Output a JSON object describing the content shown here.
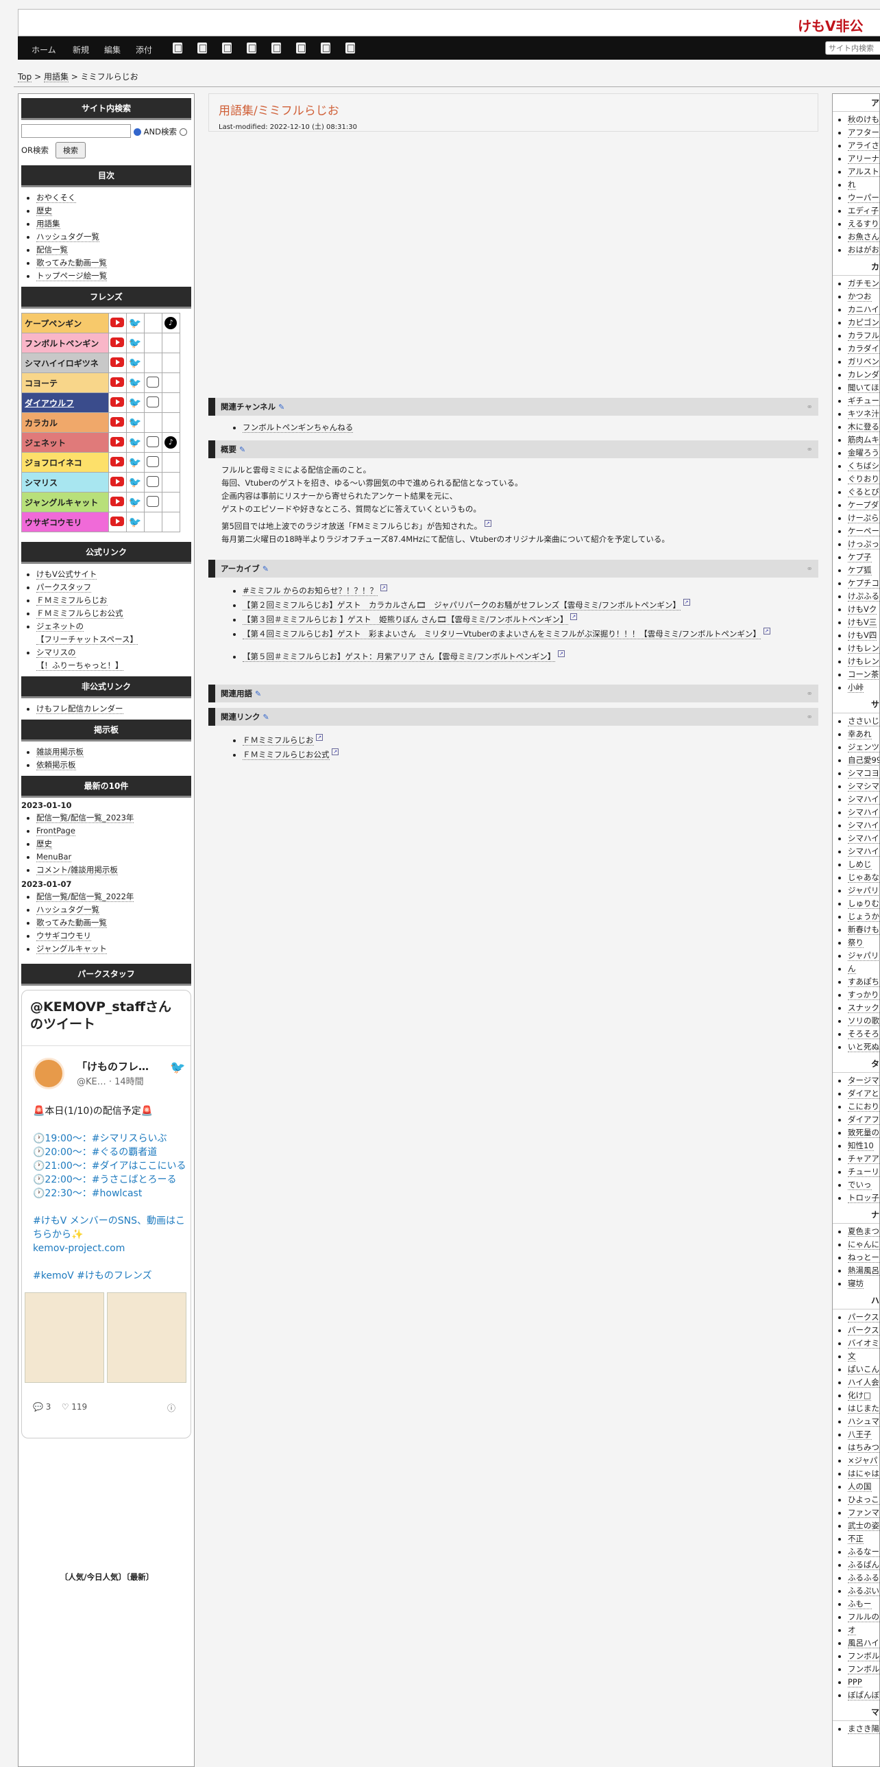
{
  "header": {
    "site_title": "けもV非公"
  },
  "nav": {
    "items": [
      "ホーム",
      "新規",
      "編集",
      "添付"
    ],
    "search_placeholder": "サイト内検索"
  },
  "breadcrumb": {
    "top": "Top",
    "sep": " > ",
    "glossary": "用語集",
    "current": "ミミフルらじお"
  },
  "left": {
    "search": {
      "heading": "サイト内検索",
      "and_label": "AND検索",
      "or_label": "OR検索",
      "button": "検索"
    },
    "toc": {
      "heading": "目次",
      "items": [
        "おやくそく",
        "歴史",
        "用語集",
        "ハッシュタグ一覧",
        "配信一覧",
        "歌ってみた動画一覧",
        "トップページ絵一覧"
      ]
    },
    "friends": {
      "heading": "フレンズ",
      "rows": [
        {
          "name": "ケープペンギン",
          "color": "#f7c96b",
          "icons": [
            "yt",
            "tw",
            "",
            "tk"
          ]
        },
        {
          "name": "フンボルトペンギン",
          "color": "#f9b6c8",
          "icons": [
            "yt",
            "tw",
            "",
            ""
          ]
        },
        {
          "name": "シマハイイロギツネ",
          "color": "#c8c8c8",
          "icons": [
            "yt",
            "tw",
            "",
            ""
          ]
        },
        {
          "name": "コヨーテ",
          "color": "#f8d68a",
          "icons": [
            "yt",
            "tw",
            "fc",
            ""
          ]
        },
        {
          "name": "ダイアウルフ",
          "color": "#3a4c8c",
          "icons": [
            "yt",
            "tw",
            "fc",
            ""
          ]
        },
        {
          "name": "カラカル",
          "color": "#f0a86a",
          "icons": [
            "yt",
            "tw",
            "",
            ""
          ]
        },
        {
          "name": "ジェネット",
          "color": "#e07a7a",
          "icons": [
            "yt",
            "tw",
            "fc",
            "tk"
          ]
        },
        {
          "name": "ジョフロイネコ",
          "color": "#fde06a",
          "icons": [
            "yt",
            "tw",
            "fc",
            ""
          ]
        },
        {
          "name": "シマリス",
          "color": "#a8e6f0",
          "icons": [
            "yt",
            "tw",
            "fc",
            ""
          ]
        },
        {
          "name": "ジャングルキャット",
          "color": "#b8e07a",
          "icons": [
            "yt",
            "tw",
            "fc",
            ""
          ]
        },
        {
          "name": "ウサギコウモリ",
          "color": "#f06ad8",
          "icons": [
            "yt",
            "tw",
            "",
            ""
          ]
        }
      ]
    },
    "official": {
      "heading": "公式リンク",
      "items": [
        "けもV公式サイト",
        "パークスタッフ",
        "ＦＭミミフルらじお",
        "ＦＭミミフルらじお公式",
        "ジェネットの\n【フリーチャットスペース】",
        "シマリスの\n【！ふりーちゃっと！】"
      ]
    },
    "unofficial": {
      "heading": "非公式リンク",
      "items": [
        "けもフレ配信カレンダー"
      ]
    },
    "bbs": {
      "heading": "掲示板",
      "items": [
        "雑談用掲示板",
        "依頼掲示板"
      ]
    },
    "recent": {
      "heading": "最新の10件",
      "groups": [
        {
          "date": "2023-01-10",
          "items": [
            "配信一覧/配信一覧_2023年",
            "FrontPage",
            "歴史",
            "MenuBar",
            "コメント/雑談用掲示板"
          ]
        },
        {
          "date": "2023-01-07",
          "items": [
            "配信一覧/配信一覧_2022年",
            "ハッシュタグ一覧",
            "歌ってみた動画一覧",
            "ウサギコウモリ",
            "ジャングルキャット"
          ]
        }
      ]
    },
    "staff": {
      "heading": "パークスタッフ"
    },
    "tweet": {
      "heading": "@KEMOVP_staffさんのツイート",
      "name": "「けものフレ…",
      "handle": "@KE… · 14時間",
      "lines": [
        "🚨本日(1/10)の配信予定🚨",
        "",
        "🕐19:00〜：#シマリスらいぶ",
        "🕐20:00〜：#ぐるの覇者道",
        "🕐21:00〜：#ダイアはここにいる",
        "🕐22:00〜：#うさこばとろーる",
        "🕐22:30〜：#howlcast",
        "",
        "#けもV メンバーのSNS、動画はこちらから✨",
        "kemov-project.com",
        "",
        "#kemoV #けものフレンズ"
      ],
      "replies": "3",
      "likes": "119"
    },
    "popular": "〔人気/今日人気〕〔最新〕"
  },
  "main": {
    "title": "用語集/ミミフルらじお",
    "modified": "Last-modified: 2022-12-10 (土) 08:31:30",
    "sections": {
      "channel": {
        "heading": "関連チャンネル",
        "items": [
          "フンボルトペンギンちゃんねる"
        ]
      },
      "summary": {
        "heading": "概要",
        "lines": [
          "フルルと雲母ミミによる配信企画のこと。",
          "毎回、Vtuberのゲストを招き、ゆる～い雰囲気の中で進められる配信となっている。",
          "企画内容は事前にリスナーから寄せられたアンケート結果を元に、",
          "ゲストのエピソードや好きなところ、質問などに答えていくというもの。"
        ],
        "line5": "第5回目では地上波でのラジオ放送「FMミミフルらじお」が告知された。",
        "line6": "毎月第二火曜日の18時半よりラジオフチューズ87.4MHzにて配信し、Vtuberのオリジナル楽曲について紹介を予定している。"
      },
      "archive": {
        "heading": "アーカイブ",
        "items": [
          "#ミミフル からのお知らせ？！？！？",
          "【第２回ミミフルらじお】ゲスト　カラカルさん🎞　ジャパリパークのお騒がせフレンズ【雲母ミミ/フンボルトペンギン】",
          "【第３回＃ミミフルらじお 】ゲスト　姫熊りぼん さん🎞【雲母ミミ/フンボルトペンギン】",
          "【第４回ミミフルらじお】ゲスト　彩まよいさん　ミリタリーVtuberのまよいさんをミミフルがぶ深掘り！！！【雲母ミミ/フンボルトペンギン】",
          "【第５回＃ミミフルらじお】ゲスト：月紫アリア さん【雲母ミミ/フンボルトペンギン】"
        ]
      },
      "terms": {
        "heading": "関連用語"
      },
      "links": {
        "heading": "関連リンク",
        "items": [
          "ＦＭミミフルらじお",
          "ＦＭミミフルらじお公式"
        ]
      }
    }
  },
  "right": {
    "groups": [
      {
        "heading": "ア",
        "items": [
          "秋のけも",
          "アフター",
          "アライさ",
          "アリーナ",
          "アルスト",
          "れ",
          "ウーパー",
          "エディ子",
          "えるすり",
          "お魚さん",
          "おはがお"
        ]
      },
      {
        "heading": "カ",
        "items": [
          "ガチモン",
          "かつお",
          "カニハイ",
          "カピゴン",
          "カラフル",
          "カラダイ",
          "ガリベン",
          "カレンダ",
          "聞いてほ",
          "ギチュー",
          "キツネ汁",
          "木に登る",
          "筋肉ムキ",
          "金曜ろう",
          "くちばシ",
          "ぐりおり",
          "ぐるとび",
          "ケープダ",
          "けーぷら",
          "ケーペー",
          "けっぷっ",
          "ケプ子",
          "ケプ狐",
          "ケプチコ",
          "けぷふる",
          "けもVク",
          "けもV三",
          "けもV四",
          "けもレン",
          "けもレン",
          "コーン茶",
          "小峠"
        ]
      },
      {
        "heading": "サ",
        "items": [
          "ささいじ",
          "幸あれ",
          "ジェンツ",
          "自己愛99",
          "シマコヨ",
          "シマシマ",
          "シマハイ",
          "シマハイ",
          "シマハイ",
          "シマハイ",
          "シマハイ",
          "しめじ",
          "じゃあな",
          "ジャパリ",
          "しゅりむ",
          "じょうか",
          "新春けも",
          "祭り",
          "ジャパリ",
          "ん",
          "すあぽち",
          "すっかり",
          "スナック",
          "ソリの歌",
          "そろそろ",
          "いと死ぬ"
        ]
      },
      {
        "heading": "タ",
        "items": [
          "タージマ",
          "ダイアと",
          "こにおり",
          "ダイアフ",
          "致死量の",
          "知性10",
          "チャアア",
          "チューリ",
          "でいっ",
          "トロッ子"
        ]
      },
      {
        "heading": "ナ",
        "items": [
          "夏色まつ",
          "にゃんに",
          "ねっとー",
          "熱湯風呂",
          "寝坊"
        ]
      },
      {
        "heading": "ハ",
        "items": [
          "パークス",
          "パークス",
          "バイオミ",
          "文",
          "ぱいこん",
          "ハイ人会",
          "化け□",
          "はじまた",
          "ハシュマ",
          "八王子",
          "はちみつ",
          "×ジャパ",
          "はにゃは",
          "人の国",
          "ひよっこ",
          "ファンマ",
          "武士の姿",
          "不正",
          "ふるなー",
          "ふるぱん",
          "ふるふる",
          "ふるぷい",
          "ふもー",
          "フルルの",
          "オ",
          "風呂ハイ",
          "フンボル",
          "フンボル",
          "PPP",
          "ぼぱんぼ"
        ]
      },
      {
        "heading": "マ",
        "items": [
          "まさき陽"
        ]
      }
    ]
  }
}
